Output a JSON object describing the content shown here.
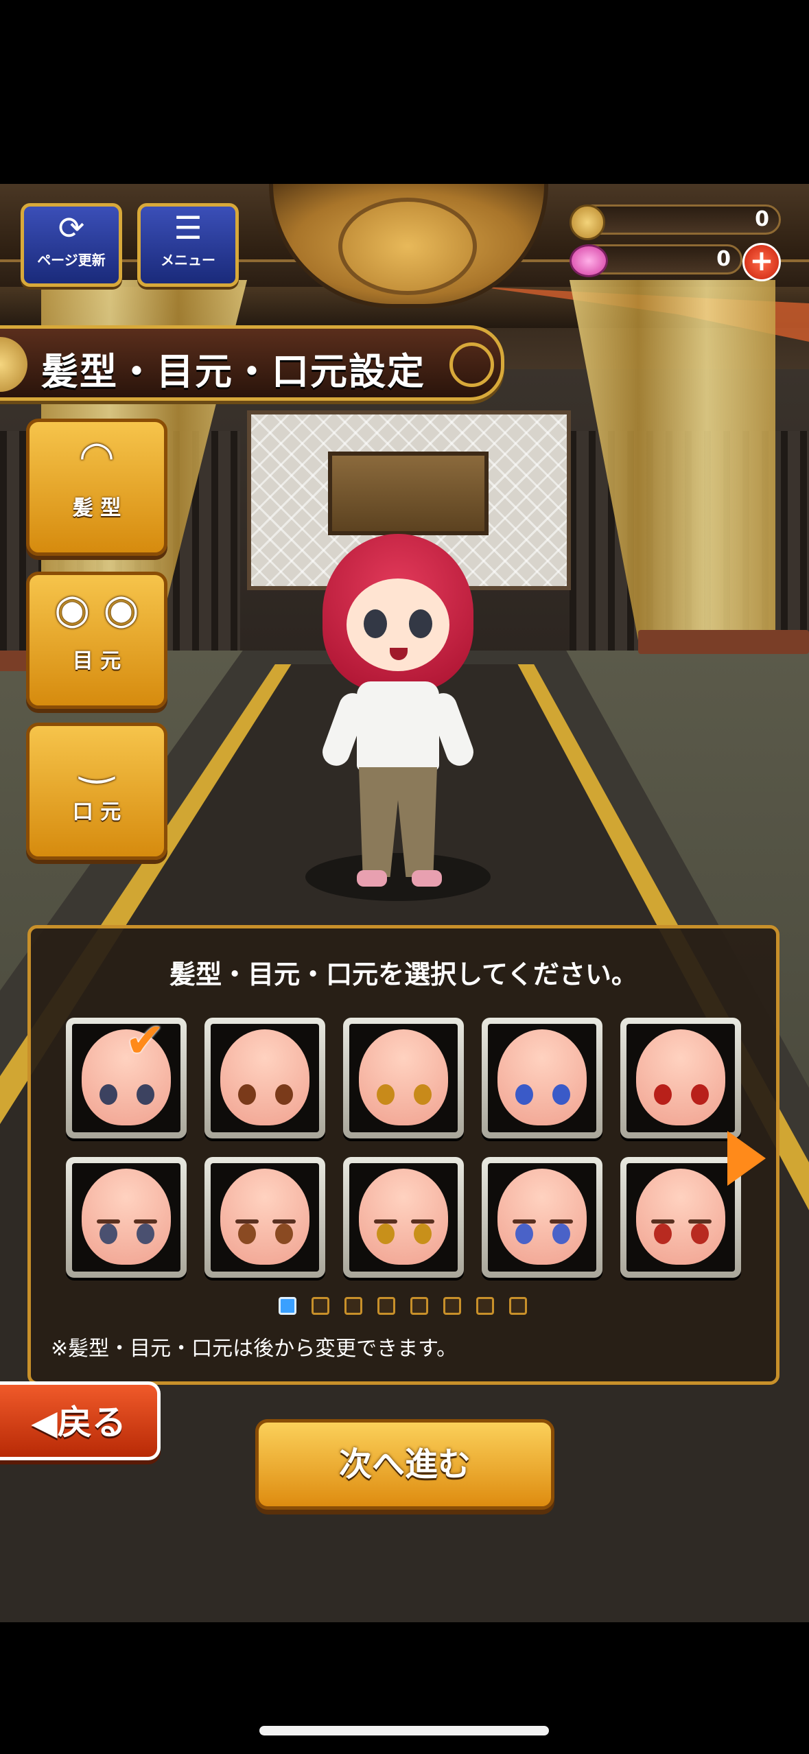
{
  "header": {
    "refresh_label": "ページ更新",
    "menu_label": "メニュー",
    "coins": "0",
    "gems": "0",
    "plus": "+"
  },
  "title": "髪型・目元・口元設定",
  "categories": [
    {
      "label": "髪 型",
      "icon": "hair-icon"
    },
    {
      "label": "目 元",
      "icon": "eyes-icon"
    },
    {
      "label": "口 元",
      "icon": "mouth-icon"
    }
  ],
  "panel": {
    "instruction": "髪型・目元・口元を選択してください。",
    "note": "※髪型・目元・口元は後から変更できます。",
    "selected_index": 0,
    "eye_colors": [
      "#3c4260",
      "#7a3a1a",
      "#c88a1a",
      "#3a5ac8",
      "#b8201a",
      "#4a5070",
      "#8a4a22",
      "#c8901a",
      "#4a62c8",
      "#b82a20"
    ],
    "page_current": 1,
    "page_total": 8
  },
  "buttons": {
    "back": "◀戻る",
    "next": "次へ進む"
  }
}
